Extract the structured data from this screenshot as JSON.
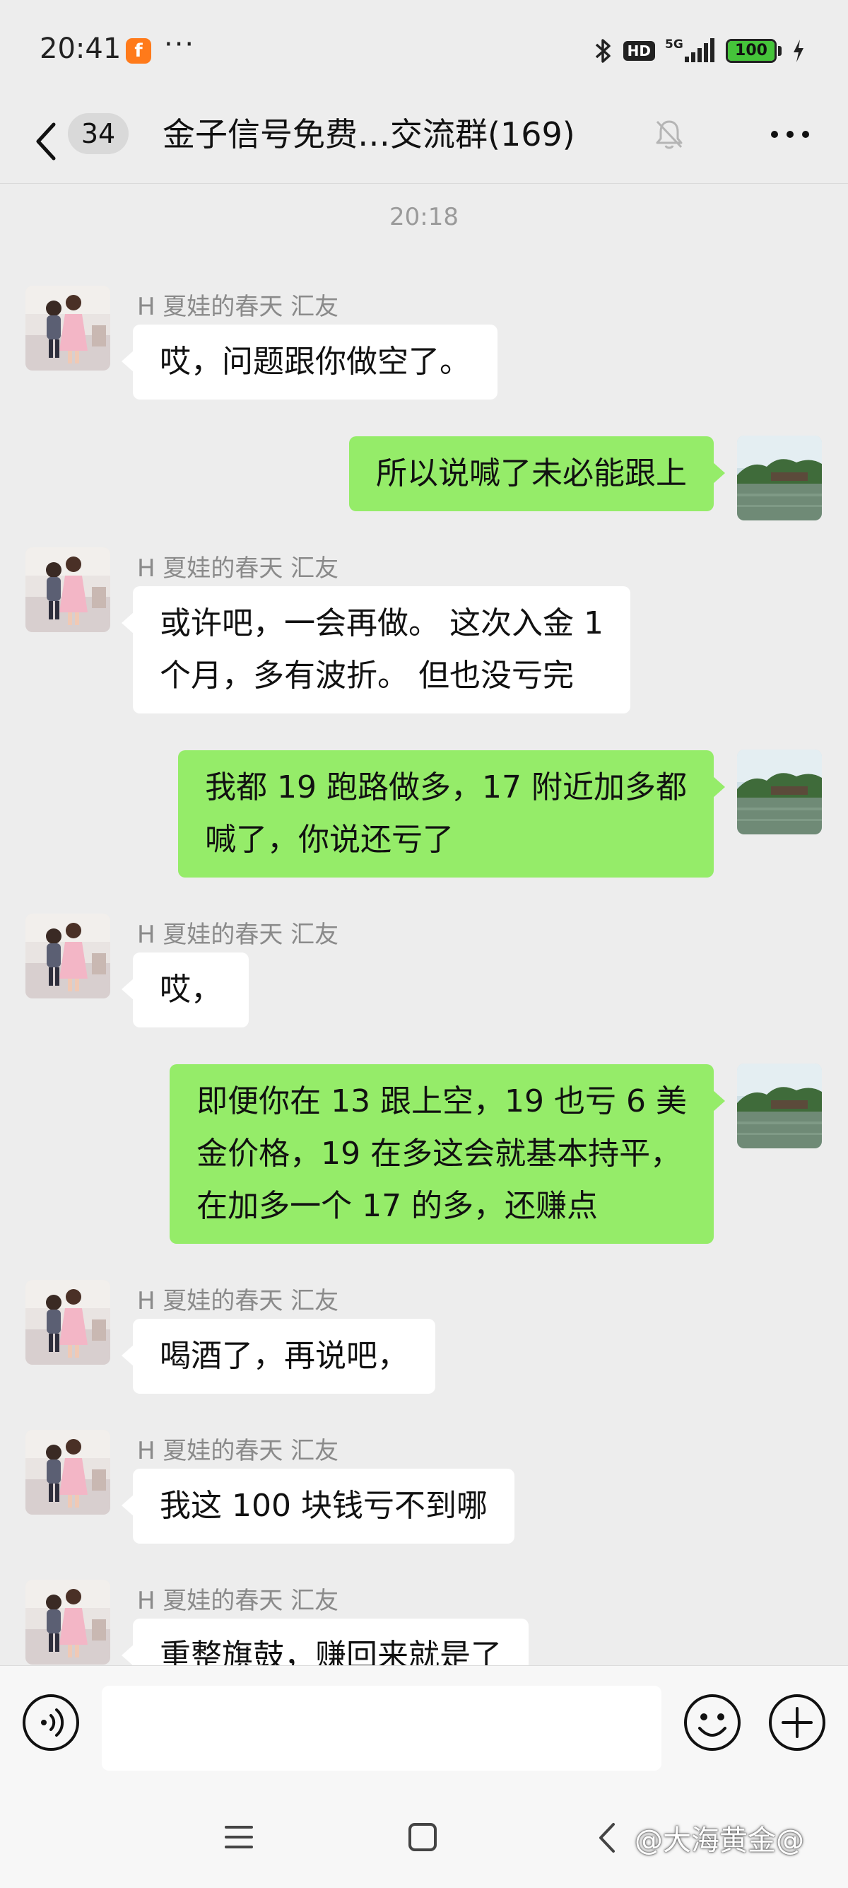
{
  "status_bar": {
    "time": "20:41",
    "more": "···",
    "hd": "HD",
    "network": "5G",
    "battery": "100",
    "battery_level": 1.0
  },
  "header": {
    "unread_count": "34",
    "title": "金子信号免费…交流群(169)"
  },
  "chat": {
    "timestamp": "20:18",
    "messages": [
      {
        "side": "left",
        "sender": "H 夏娃的春天 汇友",
        "text": "哎，问题跟你做空了。"
      },
      {
        "side": "right",
        "text": "所以说喊了未必能跟上"
      },
      {
        "side": "left",
        "sender": "H 夏娃的春天 汇友",
        "text_lines": [
          "或许吧，一会再做。 这次入金 1",
          "个月，多有波折。 但也没亏完"
        ]
      },
      {
        "side": "right",
        "text_lines": [
          "我都 19 跑路做多，17 附近加多都",
          "喊了，你说还亏了"
        ]
      },
      {
        "side": "left",
        "sender": "H 夏娃的春天 汇友",
        "text": "哎，"
      },
      {
        "side": "right",
        "text_lines": [
          "即便你在 13 跟上空，19 也亏 6 美",
          "金价格，19 在多这会就基本持平，",
          "在加多一个 17 的多，还赚点"
        ]
      },
      {
        "side": "left",
        "sender": "H 夏娃的春天 汇友",
        "text": "喝酒了，再说吧，"
      },
      {
        "side": "left",
        "sender": "H 夏娃的春天 汇友",
        "text": "我这 100 块钱亏不到哪"
      },
      {
        "side": "left",
        "sender": "H 夏娃的春天 汇友",
        "text": "重整旗鼓，赚回来就是了"
      }
    ]
  },
  "input": {
    "value": ""
  },
  "watermark": "@大海黄金@",
  "colors": {
    "background": "#ededed",
    "sent_bubble": "#95ec69",
    "received_bubble": "#ffffff",
    "battery": "#45c43a"
  },
  "icons": [
    "back-icon",
    "mute-bell-icon",
    "more-icon",
    "voice-icon",
    "emoji-icon",
    "plus-icon",
    "menu-icon",
    "home-icon",
    "nav-back-icon",
    "bluetooth-icon",
    "signal-icon",
    "charging-icon"
  ]
}
